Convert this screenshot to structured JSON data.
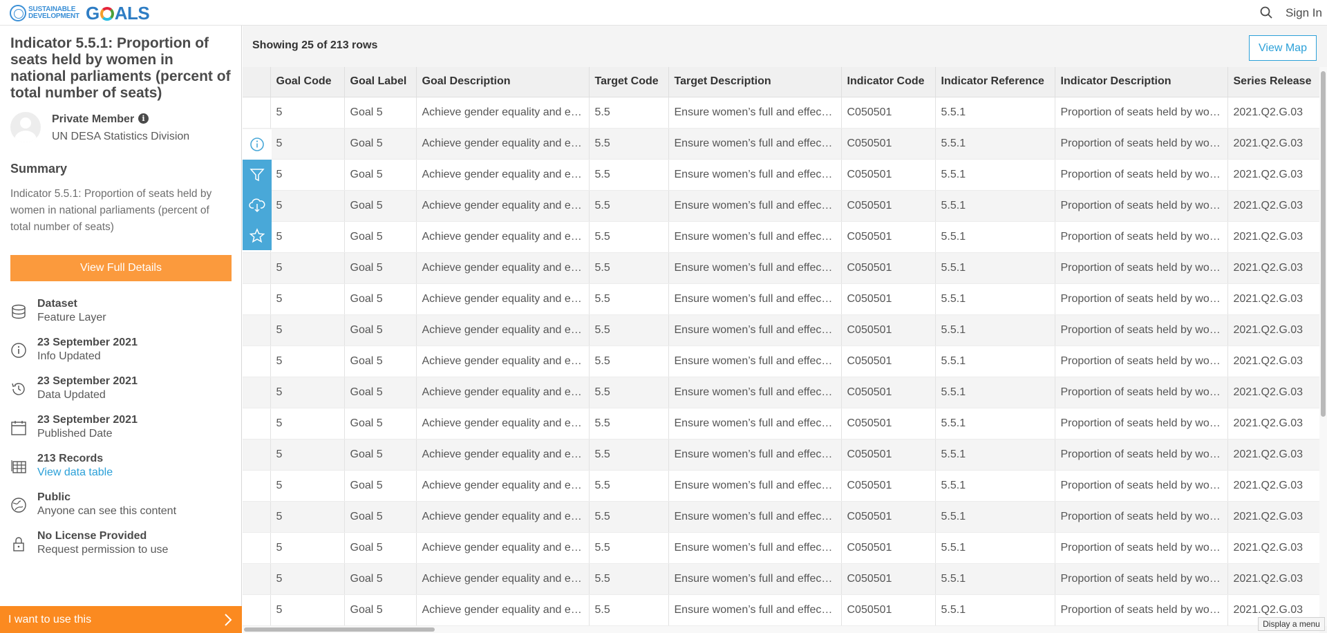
{
  "header": {
    "logo_small": "SUSTAINABLE DEVELOPMENT",
    "logo_g": "G",
    "logo_als": "ALS",
    "signin_label": "Sign In",
    "search_icon": "search-icon"
  },
  "sidebar": {
    "title": "Indicator 5.5.1: Proportion of seats held by women in national parliaments (percent of total number of seats)",
    "owner_name": "Private Member",
    "owner_org": "UN DESA Statistics Division",
    "summary_heading": "Summary",
    "summary_text": "Indicator 5.5.1: Proportion of seats held by women in national parliaments (percent of total number of seats)",
    "full_details_label": "View Full Details",
    "meta": [
      {
        "icon": "database-icon",
        "line1": "Dataset",
        "line2": "Feature Layer"
      },
      {
        "icon": "info-icon",
        "line1": "23 September 2021",
        "line2": "Info Updated"
      },
      {
        "icon": "history-icon",
        "line1": "23 September 2021",
        "line2": "Data Updated"
      },
      {
        "icon": "calendar-icon",
        "line1": "23 September 2021",
        "line2": "Published Date"
      },
      {
        "icon": "table-icon",
        "line1": "213 Records",
        "line2": "View data table"
      },
      {
        "icon": "globe-icon",
        "line1": "Public",
        "line2": "Anyone can see this content"
      },
      {
        "icon": "lock-icon",
        "line1": "No License Provided",
        "line2": "Request permission to use"
      }
    ],
    "use_label": "I want to use this",
    "accent": "#fb9a3d"
  },
  "main": {
    "row_count": "Showing 25 of 213 rows",
    "view_map_label": "View Map",
    "tool_icons": [
      "info-icon",
      "filter-icon",
      "download-icon",
      "star-icon"
    ],
    "columns": [
      "Goal Code",
      "Goal Label",
      "Goal Description",
      "Target Code",
      "Target Description",
      "Indicator Code",
      "Indicator Reference",
      "Indicator Description",
      "Series Release"
    ],
    "row": [
      "5",
      "Goal 5",
      "Achieve gender equality and empower all women and girls",
      "5.5",
      "Ensure women’s full and effective participation",
      "C050501",
      "5.5.1",
      "Proportion of seats held by women in national parliaments",
      "2021.Q2.G.03"
    ],
    "visible_rows": 17,
    "tooltip": "Display a menu"
  }
}
